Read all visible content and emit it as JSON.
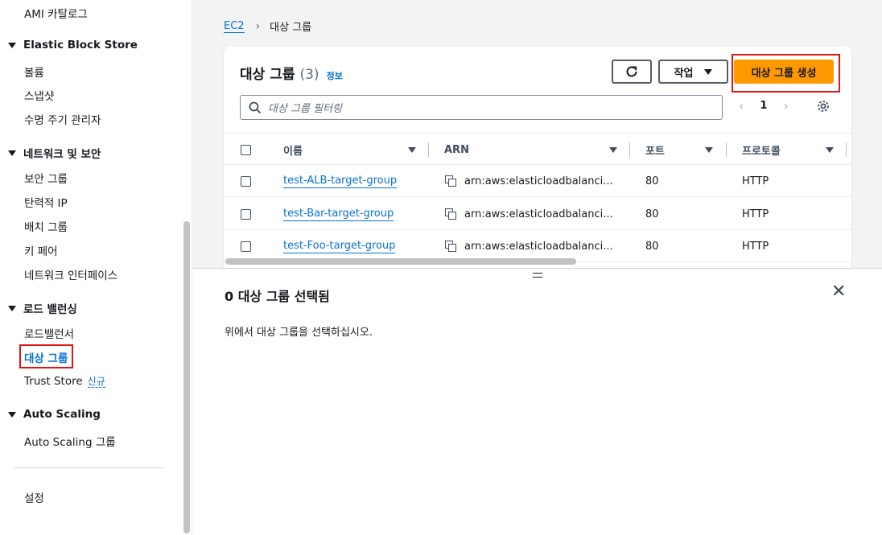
{
  "sidebar": {
    "ami_catalog": "AMI 카탈로그",
    "ebs_section": "Elastic Block Store",
    "volumes": "볼륨",
    "snapshots": "스냅샷",
    "lifecycle_manager": "수명 주기 관리자",
    "network_section": "네트워크 및 보안",
    "security_groups": "보안 그룹",
    "elastic_ip": "탄력적 IP",
    "placement_groups": "배치 그룹",
    "key_pairs": "키 페어",
    "network_interfaces": "네트워크 인터페이스",
    "lb_section": "로드 밸런싱",
    "load_balancers": "로드밸런서",
    "target_groups": "대상 그룹",
    "trust_store": "Trust Store",
    "trust_store_badge": "신규",
    "autoscaling_section": "Auto Scaling",
    "autoscaling_groups": "Auto Scaling 그룹",
    "settings": "설정"
  },
  "breadcrumb": {
    "root": "EC2",
    "current": "대상 그룹"
  },
  "panel": {
    "title": "대상 그룹",
    "count": "(3)",
    "info": "정보",
    "actions_label": "작업",
    "create_label": "대상 그룹 생성",
    "filter_placeholder": "대상 그룹 필터링",
    "page_number": "1"
  },
  "table": {
    "columns": [
      "이름",
      "ARN",
      "포트",
      "프로토콜"
    ],
    "rows": [
      {
        "name": "test-ALB-target-group",
        "arn": "arn:aws:elasticloadbalanci...",
        "port": "80",
        "protocol": "HTTP"
      },
      {
        "name": "test-Bar-target-group",
        "arn": "arn:aws:elasticloadbalanci...",
        "port": "80",
        "protocol": "HTTP"
      },
      {
        "name": "test-Foo-target-group",
        "arn": "arn:aws:elasticloadbalanci...",
        "port": "80",
        "protocol": "HTTP"
      }
    ]
  },
  "detail": {
    "title": "0 대상 그룹 선택됨",
    "message": "위에서 대상 그룹을 선택하십시오."
  },
  "colors": {
    "link": "#0972d3",
    "primary_button": "#ff9900",
    "highlight_box": "#e01515"
  }
}
